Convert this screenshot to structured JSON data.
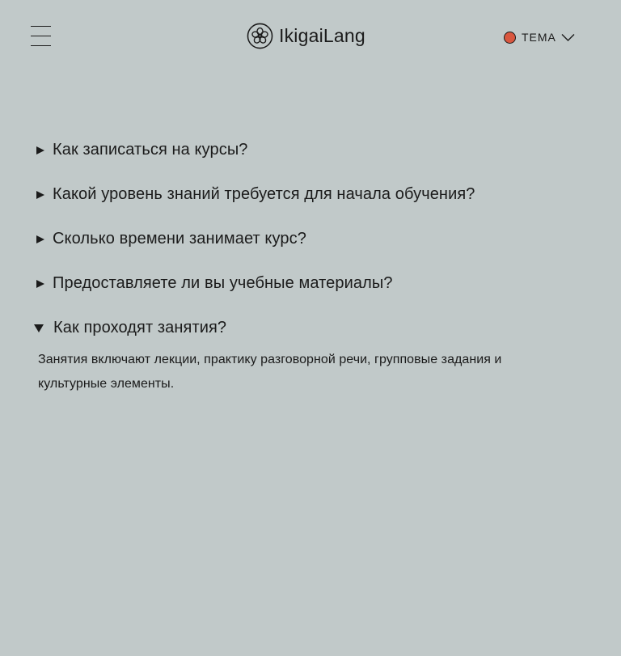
{
  "header": {
    "logo_text": "IkigaiLang",
    "theme_label": "ТЕМА",
    "theme_color": "#d9573f"
  },
  "faq": {
    "items": [
      {
        "question": "Как записаться на курсы?",
        "open": false
      },
      {
        "question": "Какой уровень знаний требуется для начала обучения?",
        "open": false
      },
      {
        "question": "Сколько времени занимает курс?",
        "open": false
      },
      {
        "question": "Предоставляете ли вы учебные материалы?",
        "open": false
      },
      {
        "question": "Как проходят занятия?",
        "open": true,
        "answer": "Занятия включают лекции, практику разговорной речи, групповые задания и культурные элементы."
      }
    ]
  },
  "icons": {
    "menu": "hamburger-menu-icon",
    "logo": "flower-logo-icon",
    "theme": "chevron-down-icon"
  },
  "colors": {
    "background": "#c1c9c9",
    "text": "#1b1b1b",
    "accent": "#d9573f"
  }
}
